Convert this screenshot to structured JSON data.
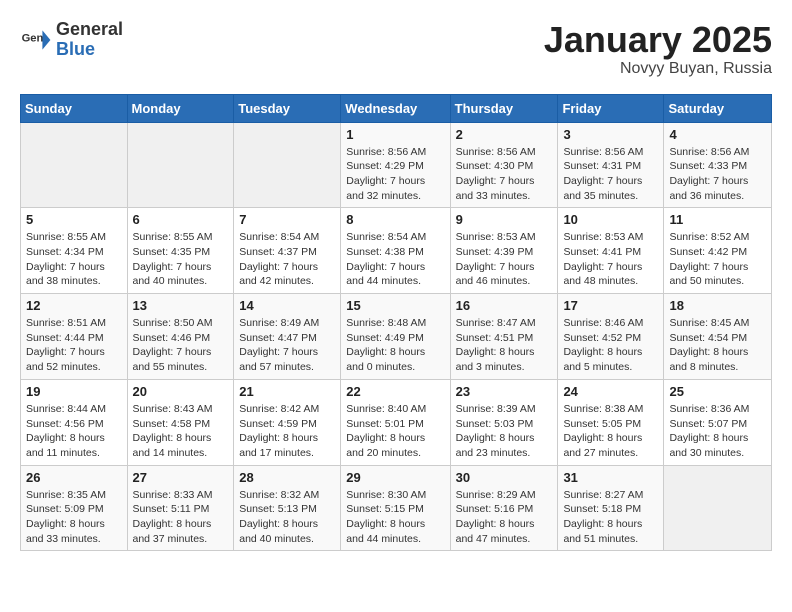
{
  "logo": {
    "general": "General",
    "blue": "Blue"
  },
  "title": "January 2025",
  "location": "Novyy Buyan, Russia",
  "days_of_week": [
    "Sunday",
    "Monday",
    "Tuesday",
    "Wednesday",
    "Thursday",
    "Friday",
    "Saturday"
  ],
  "weeks": [
    [
      {
        "day": "",
        "info": ""
      },
      {
        "day": "",
        "info": ""
      },
      {
        "day": "",
        "info": ""
      },
      {
        "day": "1",
        "info": "Sunrise: 8:56 AM\nSunset: 4:29 PM\nDaylight: 7 hours\nand 32 minutes."
      },
      {
        "day": "2",
        "info": "Sunrise: 8:56 AM\nSunset: 4:30 PM\nDaylight: 7 hours\nand 33 minutes."
      },
      {
        "day": "3",
        "info": "Sunrise: 8:56 AM\nSunset: 4:31 PM\nDaylight: 7 hours\nand 35 minutes."
      },
      {
        "day": "4",
        "info": "Sunrise: 8:56 AM\nSunset: 4:33 PM\nDaylight: 7 hours\nand 36 minutes."
      }
    ],
    [
      {
        "day": "5",
        "info": "Sunrise: 8:55 AM\nSunset: 4:34 PM\nDaylight: 7 hours\nand 38 minutes."
      },
      {
        "day": "6",
        "info": "Sunrise: 8:55 AM\nSunset: 4:35 PM\nDaylight: 7 hours\nand 40 minutes."
      },
      {
        "day": "7",
        "info": "Sunrise: 8:54 AM\nSunset: 4:37 PM\nDaylight: 7 hours\nand 42 minutes."
      },
      {
        "day": "8",
        "info": "Sunrise: 8:54 AM\nSunset: 4:38 PM\nDaylight: 7 hours\nand 44 minutes."
      },
      {
        "day": "9",
        "info": "Sunrise: 8:53 AM\nSunset: 4:39 PM\nDaylight: 7 hours\nand 46 minutes."
      },
      {
        "day": "10",
        "info": "Sunrise: 8:53 AM\nSunset: 4:41 PM\nDaylight: 7 hours\nand 48 minutes."
      },
      {
        "day": "11",
        "info": "Sunrise: 8:52 AM\nSunset: 4:42 PM\nDaylight: 7 hours\nand 50 minutes."
      }
    ],
    [
      {
        "day": "12",
        "info": "Sunrise: 8:51 AM\nSunset: 4:44 PM\nDaylight: 7 hours\nand 52 minutes."
      },
      {
        "day": "13",
        "info": "Sunrise: 8:50 AM\nSunset: 4:46 PM\nDaylight: 7 hours\nand 55 minutes."
      },
      {
        "day": "14",
        "info": "Sunrise: 8:49 AM\nSunset: 4:47 PM\nDaylight: 7 hours\nand 57 minutes."
      },
      {
        "day": "15",
        "info": "Sunrise: 8:48 AM\nSunset: 4:49 PM\nDaylight: 8 hours\nand 0 minutes."
      },
      {
        "day": "16",
        "info": "Sunrise: 8:47 AM\nSunset: 4:51 PM\nDaylight: 8 hours\nand 3 minutes."
      },
      {
        "day": "17",
        "info": "Sunrise: 8:46 AM\nSunset: 4:52 PM\nDaylight: 8 hours\nand 5 minutes."
      },
      {
        "day": "18",
        "info": "Sunrise: 8:45 AM\nSunset: 4:54 PM\nDaylight: 8 hours\nand 8 minutes."
      }
    ],
    [
      {
        "day": "19",
        "info": "Sunrise: 8:44 AM\nSunset: 4:56 PM\nDaylight: 8 hours\nand 11 minutes."
      },
      {
        "day": "20",
        "info": "Sunrise: 8:43 AM\nSunset: 4:58 PM\nDaylight: 8 hours\nand 14 minutes."
      },
      {
        "day": "21",
        "info": "Sunrise: 8:42 AM\nSunset: 4:59 PM\nDaylight: 8 hours\nand 17 minutes."
      },
      {
        "day": "22",
        "info": "Sunrise: 8:40 AM\nSunset: 5:01 PM\nDaylight: 8 hours\nand 20 minutes."
      },
      {
        "day": "23",
        "info": "Sunrise: 8:39 AM\nSunset: 5:03 PM\nDaylight: 8 hours\nand 23 minutes."
      },
      {
        "day": "24",
        "info": "Sunrise: 8:38 AM\nSunset: 5:05 PM\nDaylight: 8 hours\nand 27 minutes."
      },
      {
        "day": "25",
        "info": "Sunrise: 8:36 AM\nSunset: 5:07 PM\nDaylight: 8 hours\nand 30 minutes."
      }
    ],
    [
      {
        "day": "26",
        "info": "Sunrise: 8:35 AM\nSunset: 5:09 PM\nDaylight: 8 hours\nand 33 minutes."
      },
      {
        "day": "27",
        "info": "Sunrise: 8:33 AM\nSunset: 5:11 PM\nDaylight: 8 hours\nand 37 minutes."
      },
      {
        "day": "28",
        "info": "Sunrise: 8:32 AM\nSunset: 5:13 PM\nDaylight: 8 hours\nand 40 minutes."
      },
      {
        "day": "29",
        "info": "Sunrise: 8:30 AM\nSunset: 5:15 PM\nDaylight: 8 hours\nand 44 minutes."
      },
      {
        "day": "30",
        "info": "Sunrise: 8:29 AM\nSunset: 5:16 PM\nDaylight: 8 hours\nand 47 minutes."
      },
      {
        "day": "31",
        "info": "Sunrise: 8:27 AM\nSunset: 5:18 PM\nDaylight: 8 hours\nand 51 minutes."
      },
      {
        "day": "",
        "info": ""
      }
    ]
  ]
}
